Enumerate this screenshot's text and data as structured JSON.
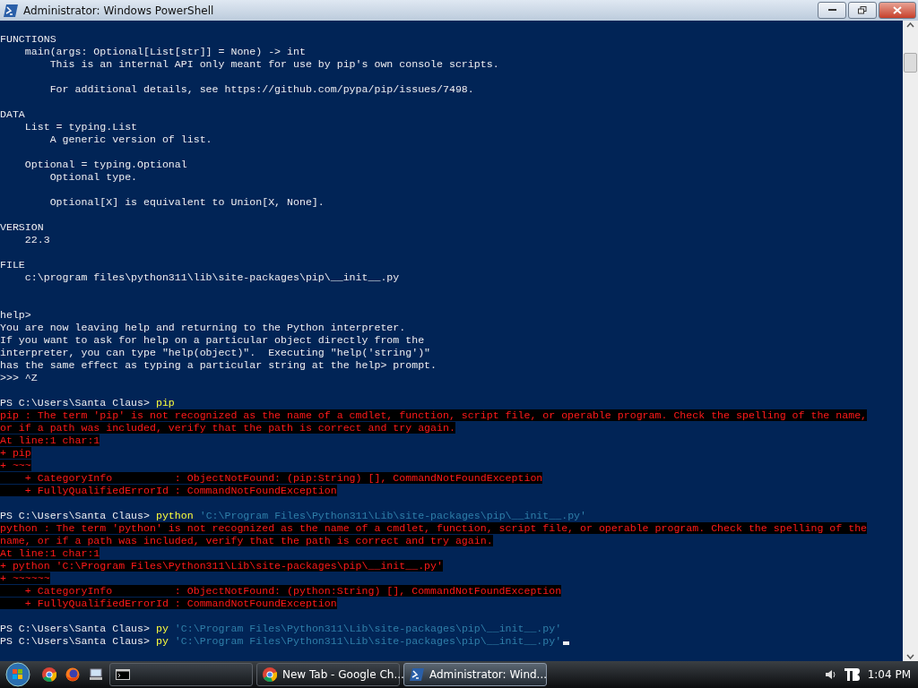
{
  "window": {
    "title": "Administrator: Windows PowerShell"
  },
  "console": {
    "lines": [
      {
        "kind": "output",
        "text": "FUNCTIONS"
      },
      {
        "kind": "output",
        "text": "    main(args: Optional[List[str]] = None) -> int"
      },
      {
        "kind": "output",
        "text": "        This is an internal API only meant for use by pip's own console scripts."
      },
      {
        "kind": "blank"
      },
      {
        "kind": "output",
        "text": "        For additional details, see https://github.com/pypa/pip/issues/7498."
      },
      {
        "kind": "blank"
      },
      {
        "kind": "output",
        "text": "DATA"
      },
      {
        "kind": "output",
        "text": "    List = typing.List"
      },
      {
        "kind": "output",
        "text": "        A generic version of list."
      },
      {
        "kind": "blank"
      },
      {
        "kind": "output",
        "text": "    Optional = typing.Optional"
      },
      {
        "kind": "output",
        "text": "        Optional type."
      },
      {
        "kind": "blank"
      },
      {
        "kind": "output",
        "text": "        Optional[X] is equivalent to Union[X, None]."
      },
      {
        "kind": "blank"
      },
      {
        "kind": "output",
        "text": "VERSION"
      },
      {
        "kind": "output",
        "text": "    22.3"
      },
      {
        "kind": "blank"
      },
      {
        "kind": "output",
        "text": "FILE"
      },
      {
        "kind": "output",
        "text": "    c:\\program files\\python311\\lib\\site-packages\\pip\\__init__.py"
      },
      {
        "kind": "blank"
      },
      {
        "kind": "blank"
      },
      {
        "kind": "output",
        "text": "help>"
      },
      {
        "kind": "output",
        "text": "You are now leaving help and returning to the Python interpreter."
      },
      {
        "kind": "output",
        "text": "If you want to ask for help on a particular object directly from the"
      },
      {
        "kind": "output",
        "text": "interpreter, you can type \"help(object)\".  Executing \"help('string')\""
      },
      {
        "kind": "output",
        "text": "has the same effect as typing a particular string at the help> prompt."
      },
      {
        "kind": "output",
        "text": ">>> ^Z"
      },
      {
        "kind": "blank"
      },
      {
        "kind": "prompt",
        "prompt": "PS C:\\Users\\Santa Claus>",
        "command": "pip"
      },
      {
        "kind": "error",
        "text": "pip : The term 'pip' is not recognized as the name of a cmdlet, function, script file, or operable program. Check the spelling of the name,"
      },
      {
        "kind": "error",
        "text": "or if a path was included, verify that the path is correct and try again."
      },
      {
        "kind": "error",
        "text": "At line:1 char:1"
      },
      {
        "kind": "error",
        "text": "+ pip"
      },
      {
        "kind": "error",
        "text": "+ ~~~"
      },
      {
        "kind": "error",
        "text": "    + CategoryInfo          : ObjectNotFound: (pip:String) [], CommandNotFoundException"
      },
      {
        "kind": "error",
        "text": "    + FullyQualifiedErrorId : CommandNotFoundException"
      },
      {
        "kind": "blank"
      },
      {
        "kind": "prompt",
        "prompt": "PS C:\\Users\\Santa Claus>",
        "command": "python",
        "argument": "'C:\\Program Files\\Python311\\Lib\\site-packages\\pip\\__init__.py'"
      },
      {
        "kind": "error",
        "text": "python : The term 'python' is not recognized as the name of a cmdlet, function, script file, or operable program. Check the spelling of the"
      },
      {
        "kind": "error",
        "text": "name, or if a path was included, verify that the path is correct and try again."
      },
      {
        "kind": "error",
        "text": "At line:1 char:1"
      },
      {
        "kind": "error",
        "text": "+ python 'C:\\Program Files\\Python311\\Lib\\site-packages\\pip\\__init__.py'"
      },
      {
        "kind": "error",
        "text": "+ ~~~~~~"
      },
      {
        "kind": "error",
        "text": "    + CategoryInfo          : ObjectNotFound: (python:String) [], CommandNotFoundException"
      },
      {
        "kind": "error",
        "text": "    + FullyQualifiedErrorId : CommandNotFoundException"
      },
      {
        "kind": "blank"
      },
      {
        "kind": "prompt",
        "prompt": "PS C:\\Users\\Santa Claus>",
        "command": "py",
        "argument": "'C:\\Program Files\\Python311\\Lib\\site-packages\\pip\\__init__.py'"
      },
      {
        "kind": "prompt",
        "prompt": "PS C:\\Users\\Santa Claus>",
        "command": "py",
        "argument": "'C:\\Program Files\\Python311\\Lib\\site-packages\\pip\\__init__.py'",
        "cursor": true
      }
    ]
  },
  "taskbar": {
    "quick_launch": [
      {
        "kind": "chrome"
      },
      {
        "kind": "firefox"
      },
      {
        "kind": "computer"
      }
    ],
    "tasks": [
      {
        "kind": "cmd",
        "selected": false
      },
      {
        "kind": "chrome",
        "label": "New Tab - Google Ch...",
        "selected": false
      },
      {
        "kind": "powershell",
        "label": "Administrator: Wind...",
        "selected": true
      }
    ],
    "clock": "1:04 PM"
  }
}
